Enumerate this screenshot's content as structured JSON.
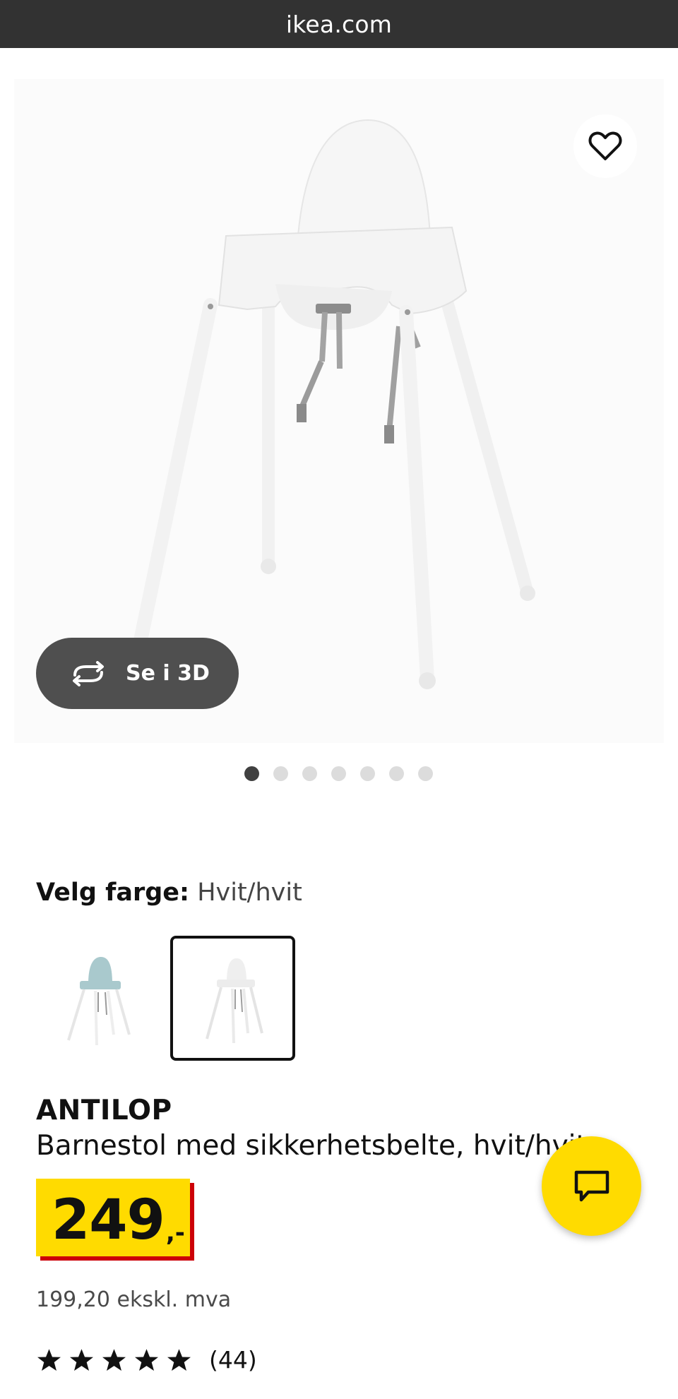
{
  "browser": {
    "url": "ikea.com"
  },
  "gallery": {
    "view_3d_label": "Se i 3D",
    "dots_count": 7,
    "active_dot": 0
  },
  "icons": {
    "favorite": "heart-outline-icon",
    "view_3d": "rotate-3d-icon",
    "chat": "chat-bubble-icon",
    "rating": "star-icon"
  },
  "color_selector": {
    "label": "Velg farge:",
    "selected_value": "Hvit/hvit",
    "swatches": [
      {
        "name": "light-turquoise",
        "selected": false
      },
      {
        "name": "white",
        "selected": true
      }
    ]
  },
  "product": {
    "name": "ANTILOP",
    "description": "Barnestol med sikkerhetsbelte, hvit/hvit",
    "price_integer": "249",
    "price_suffix": ",-",
    "price_excl_vat": "199,20 ekskl. mva",
    "rating_stars": 5,
    "review_count": "(44)"
  },
  "colors": {
    "price_yellow": "#ffdb00",
    "price_red_shadow": "#cc0008",
    "chat_yellow": "#ffdb00",
    "urlbar_bg": "#323232"
  }
}
